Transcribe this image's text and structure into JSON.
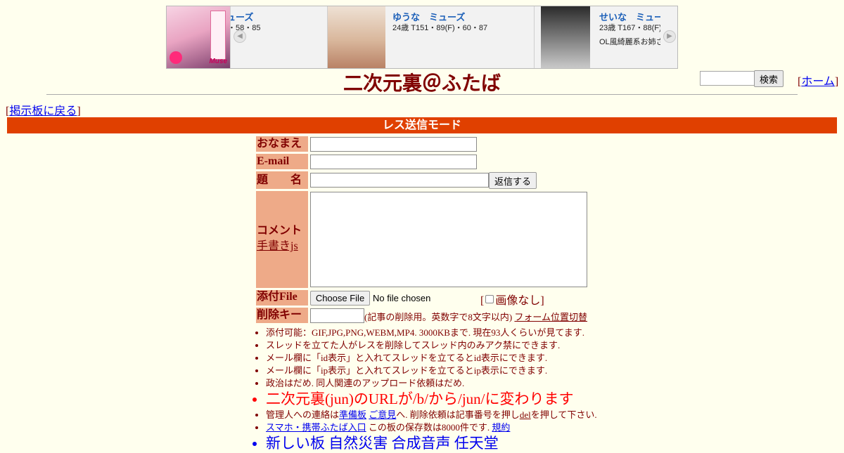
{
  "banner": {
    "ad": {
      "logo": "Muse"
    },
    "cards": [
      {
        "name": "ューズ",
        "spec": "・58・85",
        "desc": ""
      },
      {
        "name": "ゆうな　ミューズ",
        "spec": "24歳 T151・89(F)・60・87",
        "desc": ""
      },
      {
        "name": "せいな　ミュー",
        "spec": "23歳 T167・88(F)",
        "desc": "OL風綺麗系お姉さ"
      }
    ]
  },
  "header": {
    "title": "二次元裏＠ふたば",
    "search_button": "検索",
    "home_prefix": "[",
    "home_link": "ホーム",
    "home_suffix": "]"
  },
  "nav": {
    "back_prefix": "[",
    "back_link": "掲示板に戻る",
    "back_suffix": "]"
  },
  "mode_bar": "レス送信モード",
  "form": {
    "name_label": "おなまえ",
    "email_label": "E-mail",
    "subject_label": "題　　名",
    "submit_label": "返信する",
    "comment_label": "コメント",
    "handwrite_link": "手書きjs",
    "file_label": "添付File",
    "choose_file": "Choose File",
    "no_file": "No file chosen",
    "no_image_open": "[",
    "no_image_text": "画像なし]",
    "delkey_label": "削除キー",
    "delkey_hint": "(記事の削除用。英数字で8文字以内)",
    "form_position_link": "フォーム位置切替"
  },
  "notes": {
    "n1": "添付可能：GIF,JPG,PNG,WEBM,MP4. 3000KBまで. 現在93人くらいが見てます.",
    "n2": "スレッドを立てた人がレスを削除してスレッド内のみアク禁にできます.",
    "n3": "メール欄に「id表示」と入れてスレッドを立てるとid表示にできます.",
    "n4": "メール欄に「ip表示」と入れてスレッドを立てるとip表示にできます.",
    "n5": "政治はだめ. 同人関連のアップロード依頼はだめ.",
    "n6": "二次元裏(jun)のURLが/b/から/jun/に変わります",
    "n7_pre": "管理人への連絡は",
    "n7_link1": "準備板",
    "n7_link2": "ご意見",
    "n7_mid": "へ. 削除依頼は記事番号を押し",
    "n7_link3": "del",
    "n7_post": "を押して下さい.",
    "n8_link": "スマホ・携帯ふたば入口",
    "n8_mid": " この板の保存数は8000件です. ",
    "n8_link2": "規約",
    "n9": "新しい板 自然災害 合成音声 任天堂"
  },
  "colors": {
    "accent": "#e04000",
    "label_bg": "#eeaa88",
    "text": "#800000",
    "bg": "#ffffee"
  }
}
